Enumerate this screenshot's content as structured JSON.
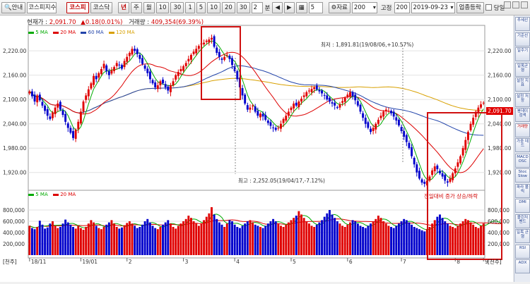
{
  "toolbar": {
    "guide": "안내",
    "index_name": "코스피지수",
    "market_kospi": "코스피",
    "market_kosdaq": "코스닥",
    "period_year": "년",
    "period_week": "주",
    "period_month": "월",
    "minute_buttons": [
      "10",
      "30",
      "1",
      "5",
      "10",
      "20",
      "30"
    ],
    "minute_value": "2",
    "minute_label": "분",
    "nav_count": "5",
    "data_label": "자료",
    "data_value": "200",
    "fixed_label": "고정",
    "fixed_value": "200",
    "date_value": "2019-09-23",
    "sector_button": "업종등락",
    "daily_label": "당일"
  },
  "info": {
    "current_label": "현재가 :",
    "current_value": "2,091.70",
    "change_value": "▲0.18(0.01%)",
    "volume_label": "거래량 :",
    "volume_value": "409,354(69.39%)"
  },
  "price_legend": [
    "5 MA",
    "20 MA",
    "60 MA",
    "120 MA"
  ],
  "volume_legend": [
    "5 MA",
    "20 MA"
  ],
  "annotations": {
    "high": "최저 : 1,891.81(19/08/06,+10.57%)",
    "low": "최고 : 2,252.05(19/04/17,-7.12%)",
    "volume_note": "전일대비 증가 상승/하락"
  },
  "price_axis": [
    "2,220.00",
    "2,160.00",
    "2,100.00",
    "2,040.00",
    "1,980.00",
    "1,920.00"
  ],
  "current_price_tag": "2,091.70",
  "volume_axis": [
    "800,000",
    "600,000",
    "400,000",
    "200,000"
  ],
  "volume_unit": "[천주]",
  "x_labels": [
    "18/11",
    "19/01",
    "2",
    "3",
    "4",
    "5",
    "6",
    "7",
    "8",
    "9"
  ],
  "sidebar": [
    "추세선",
    "기준선",
    "일주기",
    "일목균형",
    "설정 지표",
    "설정 저장",
    "봉데이 검색",
    "거래량",
    "가중 데드",
    "MACD OSC",
    "Stoc Slow",
    "파라 볼릭",
    "DMI",
    "볼린저 밴드",
    "일목 균형",
    "RSI",
    "ADX"
  ],
  "colors": {
    "up": "#e00000",
    "down": "#0000cc",
    "ma5": "#00aa00",
    "ma20": "#dd0000",
    "ma60": "#2244aa",
    "ma120": "#d8a000"
  },
  "chart_data": {
    "type": "candlestick",
    "ylim": [
      1890,
      2255
    ],
    "x_months": [
      "18/11",
      "19/01",
      "2",
      "3",
      "4",
      "5",
      "6",
      "7",
      "8",
      "9"
    ],
    "closes": [
      2120,
      2108,
      2095,
      2110,
      2098,
      2085,
      2072,
      2060,
      2052,
      2068,
      2080,
      2090,
      2075,
      2062,
      2045,
      2030,
      2018,
      2005,
      2025,
      2045,
      2070,
      2095,
      2110,
      2125,
      2140,
      2158,
      2150,
      2165,
      2175,
      2188,
      2170,
      2160,
      2172,
      2180,
      2190,
      2185,
      2176,
      2195,
      2205,
      2215,
      2225,
      2220,
      2212,
      2200,
      2188,
      2176,
      2165,
      2150,
      2140,
      2130,
      2135,
      2145,
      2140,
      2130,
      2122,
      2135,
      2145,
      2160,
      2168,
      2175,
      2182,
      2190,
      2200,
      2210,
      2218,
      2225,
      2232,
      2238,
      2240,
      2245,
      2248,
      2252,
      2230,
      2215,
      2205,
      2198,
      2205,
      2210,
      2200,
      2185,
      2170,
      2150,
      2130,
      2110,
      2090,
      2075,
      2080,
      2085,
      2070,
      2060,
      2065,
      2058,
      2050,
      2042,
      2035,
      2030,
      2025,
      2030,
      2040,
      2052,
      2060,
      2070,
      2080,
      2090,
      2085,
      2095,
      2102,
      2110,
      2118,
      2122,
      2126,
      2130,
      2125,
      2120,
      2115,
      2110,
      2100,
      2095,
      2090,
      2085,
      2080,
      2088,
      2096,
      2104,
      2112,
      2118,
      2108,
      2098,
      2085,
      2070,
      2055,
      2040,
      2030,
      2020,
      2030,
      2040,
      2050,
      2060,
      2070,
      2075,
      2072,
      2066,
      2058,
      2048,
      2036,
      2022,
      2008,
      1995,
      1980,
      1960,
      1940,
      1920,
      1905,
      1895,
      1892,
      1900,
      1910,
      1925,
      1935,
      1928,
      1918,
      1910,
      1900,
      1895,
      1905,
      1918,
      1930,
      1945,
      1960,
      1980,
      2000,
      2020,
      2040,
      2055,
      2070,
      2080,
      2088,
      2092
    ],
    "volume_ylim": [
      0,
      900000
    ],
    "volumes": [
      520,
      480,
      460,
      500,
      610,
      540,
      470,
      490,
      560,
      600,
      520,
      480,
      500,
      560,
      630,
      580,
      540,
      500,
      470,
      520,
      480,
      450,
      500,
      560,
      620,
      580,
      520,
      480,
      460,
      500,
      540,
      580,
      620,
      560,
      500,
      470,
      490,
      530,
      570,
      600,
      560,
      520,
      480,
      500,
      540,
      600,
      640,
      580,
      520,
      480,
      460,
      500,
      540,
      580,
      620,
      560,
      500,
      470,
      520,
      560,
      600,
      640,
      700,
      660,
      600,
      560,
      520,
      560,
      620,
      680,
      740,
      850,
      720,
      640,
      580,
      540,
      500,
      560,
      620,
      600,
      540,
      500,
      480,
      520,
      560,
      600,
      620,
      580,
      540,
      520,
      500,
      480,
      520,
      560,
      600,
      640,
      600,
      560,
      520,
      500,
      540,
      580,
      620,
      660,
      700,
      780,
      720,
      660,
      600,
      560,
      520,
      500,
      540,
      580,
      620,
      680,
      740,
      800,
      720,
      660,
      600,
      560,
      520,
      500,
      540,
      580,
      620,
      600,
      560,
      520,
      500,
      480,
      520,
      560,
      600,
      640,
      700,
      660,
      600,
      560,
      520,
      500,
      480,
      520,
      560,
      600,
      640,
      620,
      580,
      540,
      500,
      480,
      460,
      440,
      420,
      460,
      500,
      560,
      620,
      680,
      720,
      660,
      600,
      560,
      520,
      500,
      480,
      520,
      560,
      600,
      640,
      620,
      580,
      540,
      500,
      480,
      520,
      560,
      600,
      620,
      640,
      600,
      560,
      520,
      500
    ]
  }
}
